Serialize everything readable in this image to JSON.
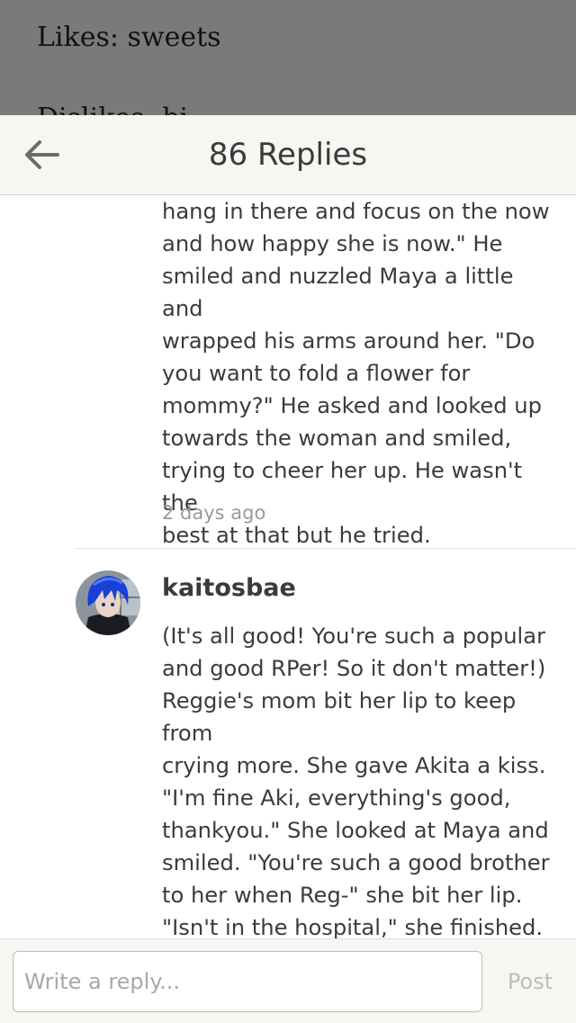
{
  "background_post": {
    "line1": "Likes: sweets",
    "line2": "Dislikes: bi..."
  },
  "header": {
    "title": "86 Replies",
    "back_icon": "arrow-left-icon"
  },
  "comments": [
    {
      "body": "hang in there and focus on the now\nand how happy she is now.\" He\nsmiled and nuzzled Maya a little and\nwrapped his arms around her. \"Do\nyou want to fold a flower for\nmommy?\" He asked and looked up\ntowards the woman and smiled,\ntrying to cheer her up. He wasn't the\nbest at that but he tried.",
      "timestamp": "2 days ago"
    },
    {
      "username": "kaitosbae",
      "body": "(It's all good! You're such a popular\nand good RPer! So it don't matter!)\nReggie's mom bit her lip to keep from\ncrying more. She gave Akita a kiss.\n\"I'm fine Aki, everything's good,\nthankyou.\" She looked at Maya and\nsmiled. \"You're such a good brother\nto her when Reg-\" she bit her lip.\n\"Isn't in the hospital,\" she finished.\nShe had remembered how Reggie"
    }
  ],
  "reply_bar": {
    "placeholder": "Write a reply...",
    "post_label": "Post"
  },
  "colors": {
    "header_bg": "#f8f6f3",
    "overlay": "#7a7a7a",
    "text": "#3b3b3b",
    "muted": "#9a9a9a",
    "avatar_hair": "#1a3fd6"
  }
}
